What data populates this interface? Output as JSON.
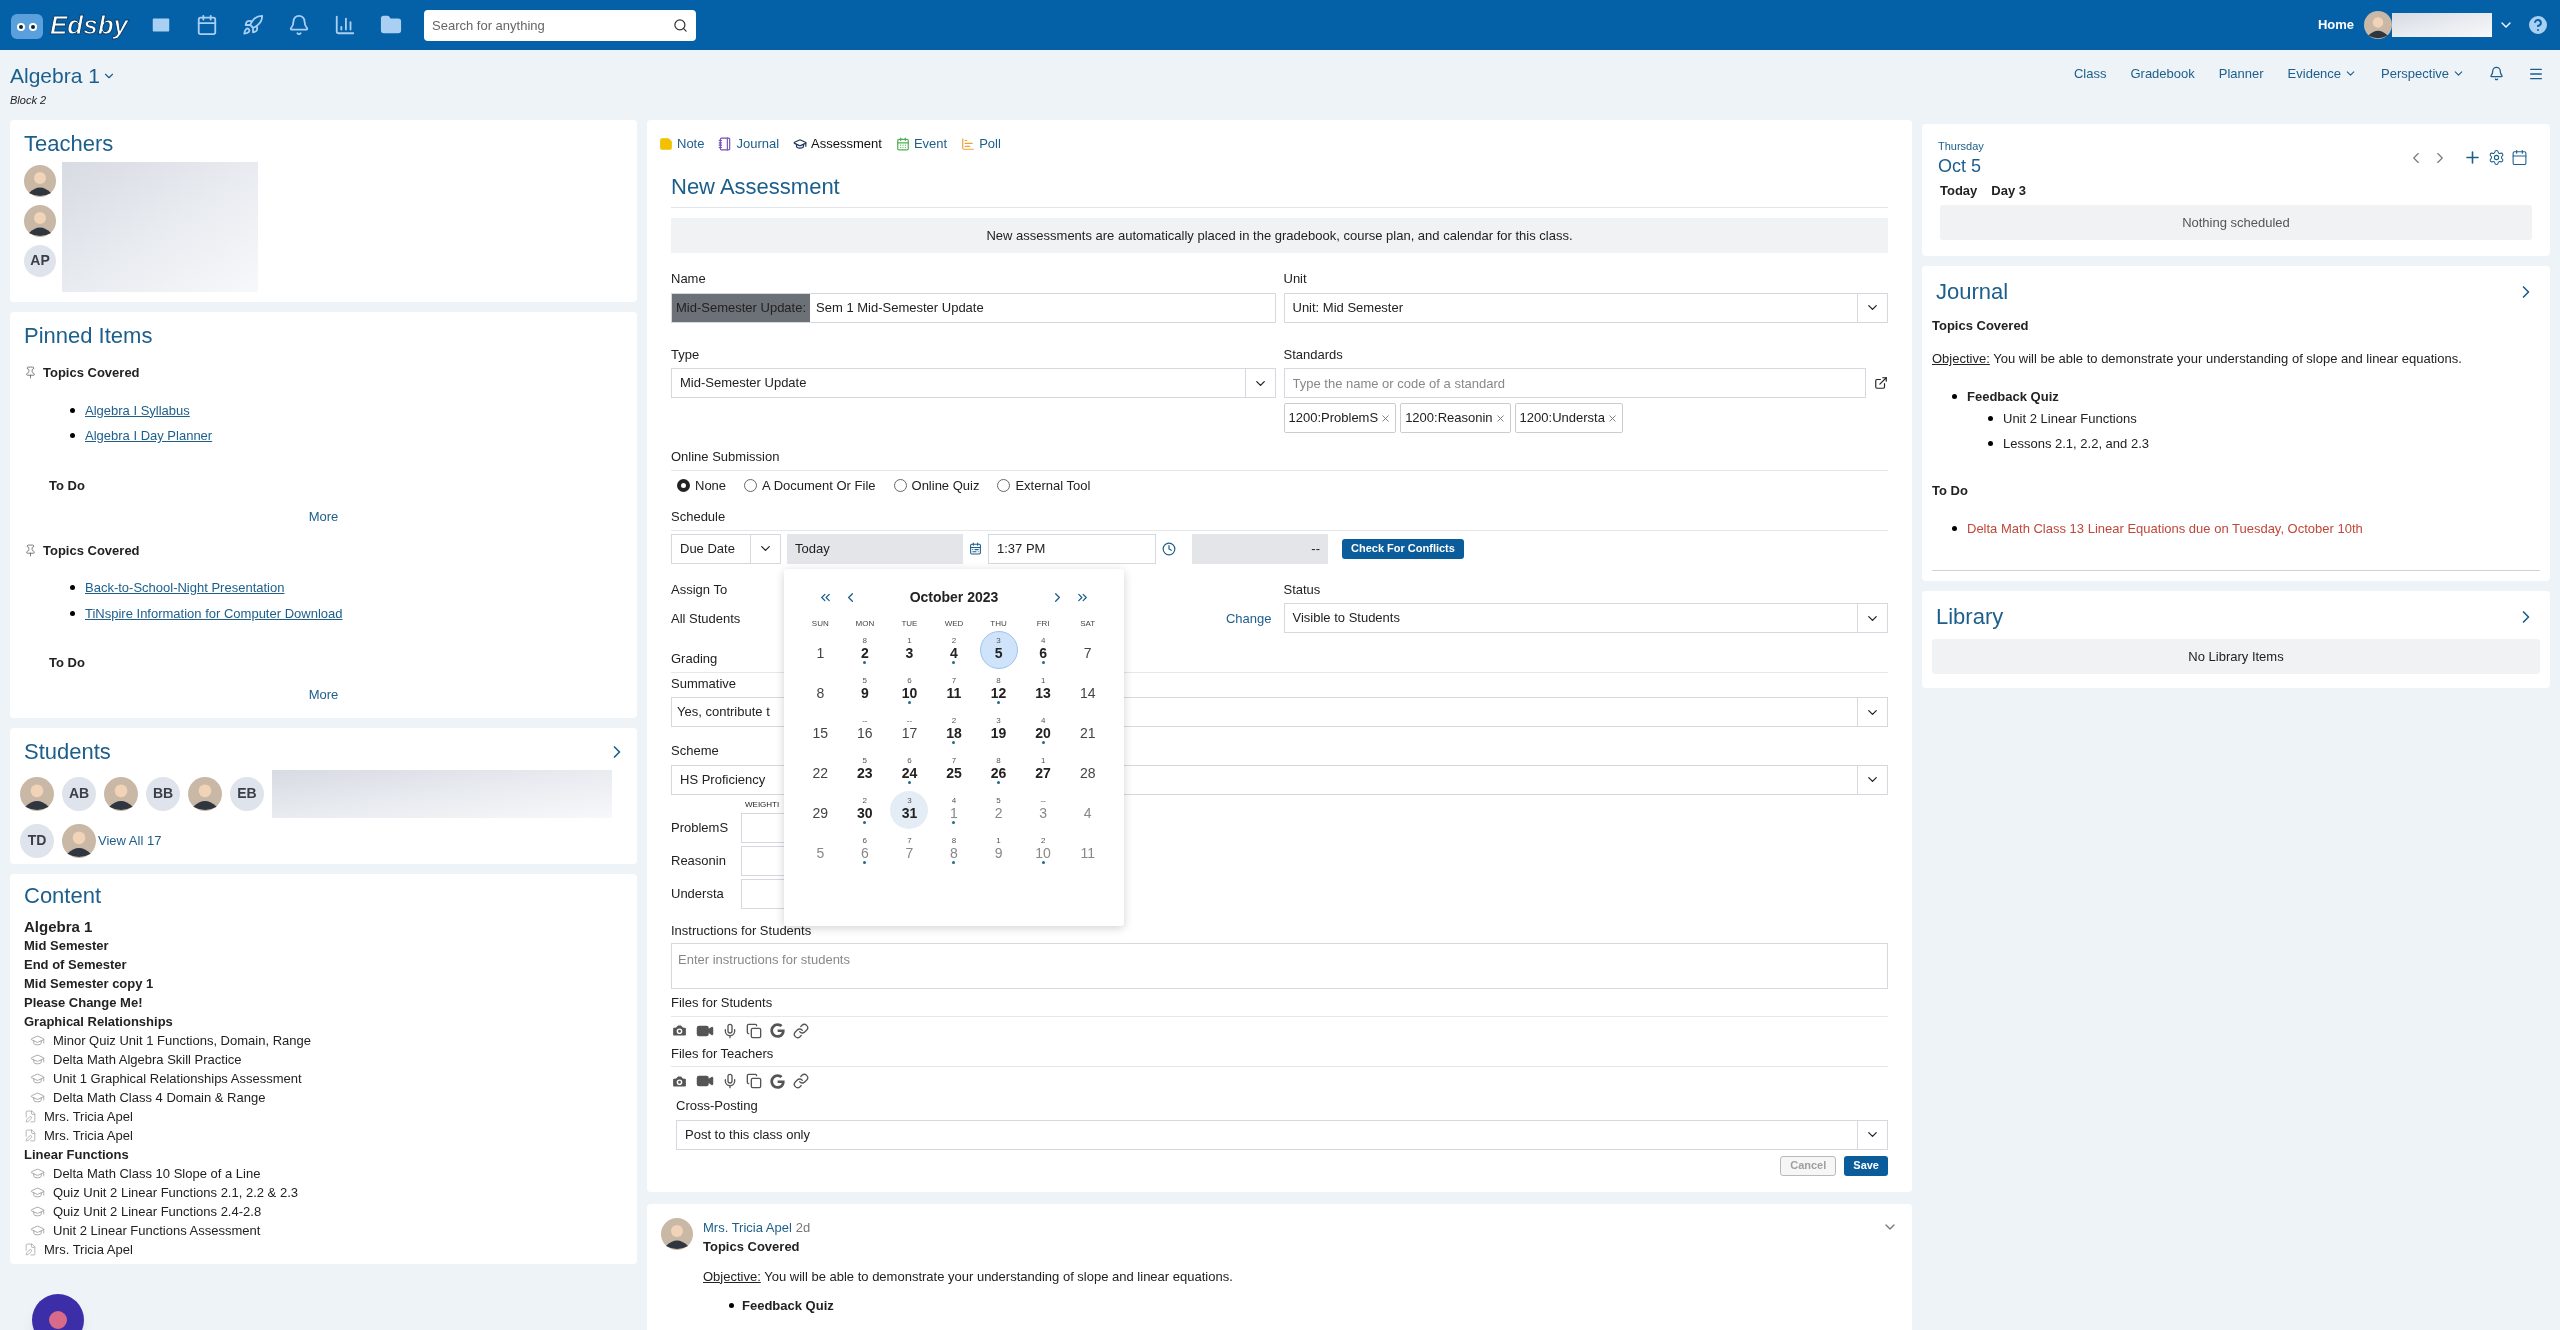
{
  "topbar": {
    "logo": "Edsby",
    "search": {
      "placeholder": "Search for anything"
    },
    "home": "Home"
  },
  "class_header": {
    "title": "Algebra 1",
    "subtitle": "Block 2",
    "nav": [
      {
        "label": "Class",
        "dropdown": false
      },
      {
        "label": "Gradebook",
        "dropdown": false
      },
      {
        "label": "Planner",
        "dropdown": false
      },
      {
        "label": "Evidence",
        "dropdown": true
      },
      {
        "label": "Perspective",
        "dropdown": true
      }
    ]
  },
  "teachers": {
    "title": "Teachers",
    "members": [
      {
        "kind": "photo"
      },
      {
        "kind": "photo"
      },
      {
        "kind": "initials",
        "initials": "AP"
      }
    ]
  },
  "pinned": {
    "title": "Pinned Items",
    "items": [
      {
        "title": "Topics Covered",
        "links": [
          "Algebra I Syllabus",
          "Algebra I Day Planner"
        ],
        "todo": "To Do",
        "more": "More"
      },
      {
        "title": "Topics Covered",
        "links": [
          "Back-to-School-Night Presentation",
          "TiNspire Information for Computer Download"
        ],
        "todo": "To Do",
        "more": "More"
      }
    ]
  },
  "students": {
    "title": "Students",
    "members": [
      {
        "kind": "photo"
      },
      {
        "kind": "initials",
        "initials": "AB"
      },
      {
        "kind": "photo"
      },
      {
        "kind": "initials",
        "initials": "BB"
      },
      {
        "kind": "photo"
      },
      {
        "kind": "initials",
        "initials": "EB"
      },
      {
        "kind": "initials",
        "initials": "TD"
      },
      {
        "kind": "photo"
      }
    ],
    "view_all": "View All 17"
  },
  "content": {
    "title": "Content",
    "items": [
      {
        "kind": "course",
        "label": "Algebra 1"
      },
      {
        "kind": "unit",
        "label": "Mid Semester"
      },
      {
        "kind": "unit",
        "label": "End of Semester"
      },
      {
        "kind": "unit",
        "label": "Mid Semester copy 1"
      },
      {
        "kind": "unit",
        "label": "Please Change Me!"
      },
      {
        "kind": "unit",
        "label": "Graphical Relationships",
        "children": [
          {
            "kind": "assessment",
            "label": "Minor Quiz Unit 1 Functions, Domain, Range"
          },
          {
            "kind": "assessment",
            "label": "Delta Math Algebra Skill Practice"
          },
          {
            "kind": "assessment",
            "label": "Unit 1 Graphical Relationships Assessment"
          },
          {
            "kind": "assessment",
            "label": "Delta Math Class 4 Domain & Range"
          },
          {
            "kind": "journal",
            "label": "Mrs. Tricia Apel"
          },
          {
            "kind": "journal",
            "label": "Mrs. Tricia Apel"
          }
        ]
      },
      {
        "kind": "unit",
        "label": "Linear Functions",
        "children": [
          {
            "kind": "assessment",
            "label": "Delta Math Class 10 Slope of a Line"
          },
          {
            "kind": "assessment",
            "label": "Quiz Unit 2 Linear Functions 2.1, 2.2 & 2.3"
          },
          {
            "kind": "assessment",
            "label": "Quiz Unit 2 Linear Functions 2.4-2.8"
          },
          {
            "kind": "assessment",
            "label": "Unit 2 Linear Functions Assessment"
          },
          {
            "kind": "journal",
            "label": "Mrs. Tricia Apel"
          }
        ]
      }
    ]
  },
  "composer": {
    "tabs": [
      {
        "kind": "note",
        "label": "Note",
        "selected": false
      },
      {
        "kind": "journal",
        "label": "Journal",
        "selected": false
      },
      {
        "kind": "assessment",
        "label": "Assessment",
        "selected": true
      },
      {
        "kind": "event",
        "label": "Event",
        "selected": false
      },
      {
        "kind": "poll",
        "label": "Poll",
        "selected": false
      }
    ],
    "title": "New Assessment",
    "notice": "New assessments are automatically placed in the gradebook, course plan, and calendar for this class.",
    "name": {
      "label": "Name",
      "prefix": "Mid-Semester Update:",
      "value": "Sem 1 Mid-Semester Update"
    },
    "unit": {
      "label": "Unit",
      "value": "Unit: Mid Semester"
    },
    "type": {
      "label": "Type",
      "value": "Mid-Semester Update"
    },
    "standards": {
      "label": "Standards",
      "placeholder": "Type the name or code of a standard",
      "tags": [
        "1200:ProblemS",
        "1200:Reasonin",
        "1200:Understa"
      ]
    },
    "online_submission": {
      "label": "Online Submission",
      "options": [
        {
          "label": "None",
          "selected": true
        },
        {
          "label": "A Document Or File",
          "selected": false
        },
        {
          "label": "Online Quiz",
          "selected": false
        },
        {
          "label": "External Tool",
          "selected": false
        }
      ]
    },
    "schedule": {
      "label": "Schedule",
      "mode": "Due Date",
      "date": "Today",
      "time": "1:37 PM",
      "end": "--",
      "conflicts_button": "Check For Conflicts"
    },
    "calendar": {
      "month": "October 2023",
      "weekdays": [
        "SUN",
        "MON",
        "TUE",
        "WED",
        "THU",
        "FRI",
        "SAT"
      ],
      "days": [
        {
          "day": "1",
          "kind": "off",
          "dot": false,
          "selected": false,
          "today": false
        },
        {
          "day": "2",
          "cycle": "8",
          "kind": "school",
          "dot": true,
          "selected": false,
          "today": false
        },
        {
          "day": "3",
          "cycle": "1",
          "kind": "school",
          "dot": false,
          "selected": false,
          "today": false
        },
        {
          "day": "4",
          "cycle": "2",
          "kind": "school",
          "dot": true,
          "selected": false,
          "today": false
        },
        {
          "day": "5",
          "cycle": "3",
          "kind": "school",
          "dot": false,
          "selected": true,
          "today": false
        },
        {
          "day": "6",
          "cycle": "4",
          "kind": "school",
          "dot": true,
          "selected": false,
          "today": false
        },
        {
          "day": "7",
          "kind": "off",
          "dot": false,
          "selected": false,
          "today": false
        },
        {
          "day": "8",
          "kind": "off",
          "dot": false,
          "selected": false,
          "today": false
        },
        {
          "day": "9",
          "cycle": "5",
          "kind": "school",
          "dot": false,
          "selected": false,
          "today": false
        },
        {
          "day": "10",
          "cycle": "6",
          "kind": "school",
          "dot": true,
          "selected": false,
          "today": false
        },
        {
          "day": "11",
          "cycle": "7",
          "kind": "school",
          "dot": false,
          "selected": false,
          "today": false
        },
        {
          "day": "12",
          "cycle": "8",
          "kind": "school",
          "dot": true,
          "selected": false,
          "today": false
        },
        {
          "day": "13",
          "cycle": "1",
          "kind": "school",
          "dot": false,
          "selected": false,
          "today": false
        },
        {
          "day": "14",
          "kind": "off",
          "dot": false,
          "selected": false,
          "today": false
        },
        {
          "day": "15",
          "kind": "off",
          "dot": false,
          "selected": false,
          "today": false
        },
        {
          "day": "16",
          "cycle": "--",
          "kind": "off",
          "dot": false,
          "selected": false,
          "today": false
        },
        {
          "day": "17",
          "cycle": "--",
          "kind": "off",
          "dot": false,
          "selected": false,
          "today": false
        },
        {
          "day": "18",
          "cycle": "2",
          "kind": "school",
          "dot": true,
          "selected": false,
          "today": false
        },
        {
          "day": "19",
          "cycle": "3",
          "kind": "school",
          "dot": false,
          "selected": false,
          "today": false
        },
        {
          "day": "20",
          "cycle": "4",
          "kind": "school",
          "dot": true,
          "selected": false,
          "today": false
        },
        {
          "day": "21",
          "kind": "off",
          "dot": false,
          "selected": false,
          "today": false
        },
        {
          "day": "22",
          "kind": "off",
          "dot": false,
          "selected": false,
          "today": false
        },
        {
          "day": "23",
          "cycle": "5",
          "kind": "school",
          "dot": false,
          "selected": false,
          "today": false
        },
        {
          "day": "24",
          "cycle": "6",
          "kind": "school",
          "dot": true,
          "selected": false,
          "today": false
        },
        {
          "day": "25",
          "cycle": "7",
          "kind": "school",
          "dot": false,
          "selected": false,
          "today": false
        },
        {
          "day": "26",
          "cycle": "8",
          "kind": "school",
          "dot": true,
          "selected": false,
          "today": false
        },
        {
          "day": "27",
          "cycle": "1",
          "kind": "school",
          "dot": false,
          "selected": false,
          "today": false
        },
        {
          "day": "28",
          "kind": "off",
          "dot": false,
          "selected": false,
          "today": false
        },
        {
          "day": "29",
          "kind": "off",
          "dot": false,
          "selected": false,
          "today": false
        },
        {
          "day": "30",
          "cycle": "2",
          "kind": "school",
          "dot": true,
          "selected": false,
          "today": false
        },
        {
          "day": "31",
          "cycle": "3",
          "kind": "school",
          "dot": false,
          "selected": false,
          "today": true
        },
        {
          "day": "1",
          "cycle": "4",
          "kind": "next",
          "dot": true,
          "selected": false,
          "today": false
        },
        {
          "day": "2",
          "cycle": "5",
          "kind": "next",
          "dot": false,
          "selected": false,
          "today": false
        },
        {
          "day": "3",
          "cycle": "--",
          "kind": "next",
          "dot": false,
          "selected": false,
          "today": false
        },
        {
          "day": "4",
          "kind": "next",
          "dot": false,
          "selected": false,
          "today": false
        },
        {
          "day": "5",
          "kind": "next",
          "dot": false,
          "selected": false,
          "today": false
        },
        {
          "day": "6",
          "cycle": "6",
          "kind": "next",
          "dot": true,
          "selected": false,
          "today": false
        },
        {
          "day": "7",
          "cycle": "7",
          "kind": "next",
          "dot": false,
          "selected": false,
          "today": false
        },
        {
          "day": "8",
          "cycle": "8",
          "kind": "next",
          "dot": true,
          "selected": false,
          "today": false
        },
        {
          "day": "9",
          "cycle": "1",
          "kind": "next",
          "dot": false,
          "selected": false,
          "today": false
        },
        {
          "day": "10",
          "cycle": "2",
          "kind": "next",
          "dot": true,
          "selected": false,
          "today": false
        },
        {
          "day": "11",
          "kind": "next",
          "dot": false,
          "selected": false,
          "today": false
        }
      ]
    },
    "assign_to": {
      "label": "Assign To",
      "value": "All Students",
      "change": "Change"
    },
    "status": {
      "label": "Status",
      "value": "Visible to Students"
    },
    "grading": {
      "label": "Grading",
      "summative_label": "Summative",
      "summative_value": "Yes, contribute t",
      "scheme_label": "Scheme",
      "scheme_value": "HS Proficiency",
      "weighting_label": "WEIGHTI",
      "weights": [
        "ProblemS",
        "Reasonin",
        "Understa"
      ]
    },
    "instructions": {
      "label": "Instructions for Students",
      "placeholder": "Enter instructions for students"
    },
    "files": [
      {
        "label": "Files for Students"
      },
      {
        "label": "Files for Teachers"
      }
    ],
    "cross_posting": {
      "label": "Cross-Posting",
      "value": "Post to this class only"
    },
    "buttons": [
      {
        "kind": "cancel",
        "label": "Cancel",
        "disabled": true
      },
      {
        "kind": "save",
        "label": "Save",
        "disabled": false
      }
    ]
  },
  "post": {
    "author": "Mrs. Tricia Apel",
    "age": "2d",
    "title": "Topics Covered",
    "objective_label": "Objective:",
    "objective_text": "You will be able to demonstrate your understanding of slope and linear equations.",
    "bullets": [
      "Feedback Quiz"
    ]
  },
  "day": {
    "weekday": "Thursday",
    "date": "Oct 5",
    "today": "Today",
    "day": "Day 3",
    "empty": "Nothing scheduled"
  },
  "journal": {
    "title": "Journal",
    "heading": "Topics Covered",
    "objective_label": "Objective:",
    "objective_text": "You will be able to demonstrate your understanding of slope and linear equations.",
    "items": [
      {
        "label": "Feedback Quiz",
        "children": [
          {
            "label": "Unit 2 Linear Functions"
          },
          {
            "label": "Lessons 2.1, 2.2, and 2.3"
          }
        ]
      }
    ],
    "todo_heading": "To Do",
    "todos": [
      "Delta Math Class 13 Linear Equations due on Tuesday, October 10th"
    ]
  },
  "library": {
    "title": "Library",
    "empty": "No Library Items"
  }
}
